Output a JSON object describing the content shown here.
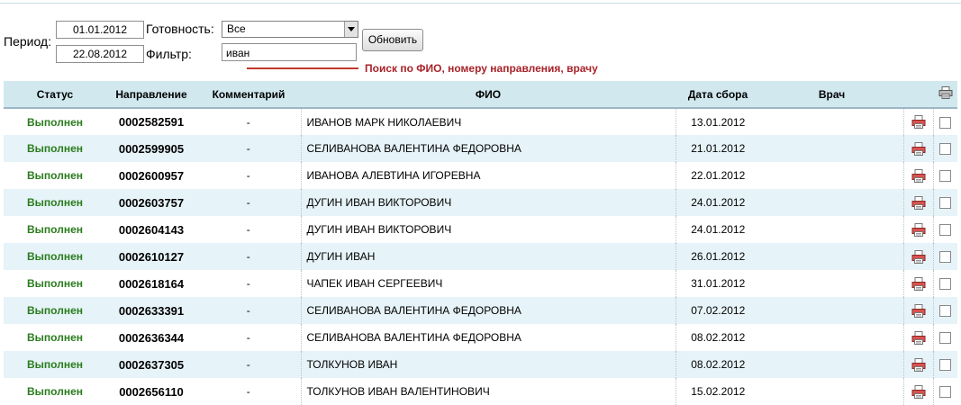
{
  "form": {
    "period_label": "Период:",
    "date_from": "01.01.2012",
    "date_to": "22.08.2012",
    "readiness_label": "Готовность:",
    "readiness_value": "Все",
    "filter_label": "Фильтр:",
    "filter_value": "иван",
    "refresh_label": "Обновить",
    "hint": "Поиск по ФИО, номеру направления, врачу"
  },
  "table": {
    "headers": {
      "status": "Статус",
      "direction": "Направление",
      "comment": "Комментарий",
      "fio": "ФИО",
      "date": "Дата сбора",
      "doctor": "Врач"
    },
    "icons": {
      "print_all": "printer-icon",
      "row_print": "printer-red-icon"
    },
    "colors": {
      "status": "#2a7c1d",
      "hint": "#a8232a",
      "header_bg": "#d1e8ef",
      "row_alt_bg": "#e6f3f8"
    },
    "rows": [
      {
        "status": "Выполнен",
        "direction": "0002582591",
        "comment": "-",
        "fio": "ИВАНОВ МАРК НИКОЛАЕВИЧ",
        "date": "13.01.2012",
        "doctor": ""
      },
      {
        "status": "Выполнен",
        "direction": "0002599905",
        "comment": "-",
        "fio": "СЕЛИВАНОВА ВАЛЕНТИНА ФЕДОРОВНА",
        "date": "21.01.2012",
        "doctor": ""
      },
      {
        "status": "Выполнен",
        "direction": "0002600957",
        "comment": "-",
        "fio": "ИВАНОВА АЛЕВТИНА ИГОРЕВНА",
        "date": "22.01.2012",
        "doctor": ""
      },
      {
        "status": "Выполнен",
        "direction": "0002603757",
        "comment": "-",
        "fio": "ДУГИН ИВАН ВИКТОРОВИЧ",
        "date": "24.01.2012",
        "doctor": ""
      },
      {
        "status": "Выполнен",
        "direction": "0002604143",
        "comment": "-",
        "fio": "ДУГИН ИВАН ВИКТОРОВИЧ",
        "date": "24.01.2012",
        "doctor": ""
      },
      {
        "status": "Выполнен",
        "direction": "0002610127",
        "comment": "-",
        "fio": "ДУГИН ИВАН",
        "date": "26.01.2012",
        "doctor": ""
      },
      {
        "status": "Выполнен",
        "direction": "0002618164",
        "comment": "-",
        "fio": "ЧАПЕК ИВАН СЕРГЕЕВИЧ",
        "date": "31.01.2012",
        "doctor": ""
      },
      {
        "status": "Выполнен",
        "direction": "0002633391",
        "comment": "-",
        "fio": "СЕЛИВАНОВА ВАЛЕНТИНА ФЕДОРОВНА",
        "date": "07.02.2012",
        "doctor": ""
      },
      {
        "status": "Выполнен",
        "direction": "0002636344",
        "comment": "-",
        "fio": "СЕЛИВАНОВА ВАЛЕНТИНА ФЕДОРОВНА",
        "date": "08.02.2012",
        "doctor": ""
      },
      {
        "status": "Выполнен",
        "direction": "0002637305",
        "comment": "-",
        "fio": "ТОЛКУНОВ ИВАН",
        "date": "08.02.2012",
        "doctor": ""
      },
      {
        "status": "Выполнен",
        "direction": "0002656110",
        "comment": "-",
        "fio": "ТОЛКУНОВ ИВАН ВАЛЕНТИНОВИЧ",
        "date": "15.02.2012",
        "doctor": ""
      }
    ]
  }
}
